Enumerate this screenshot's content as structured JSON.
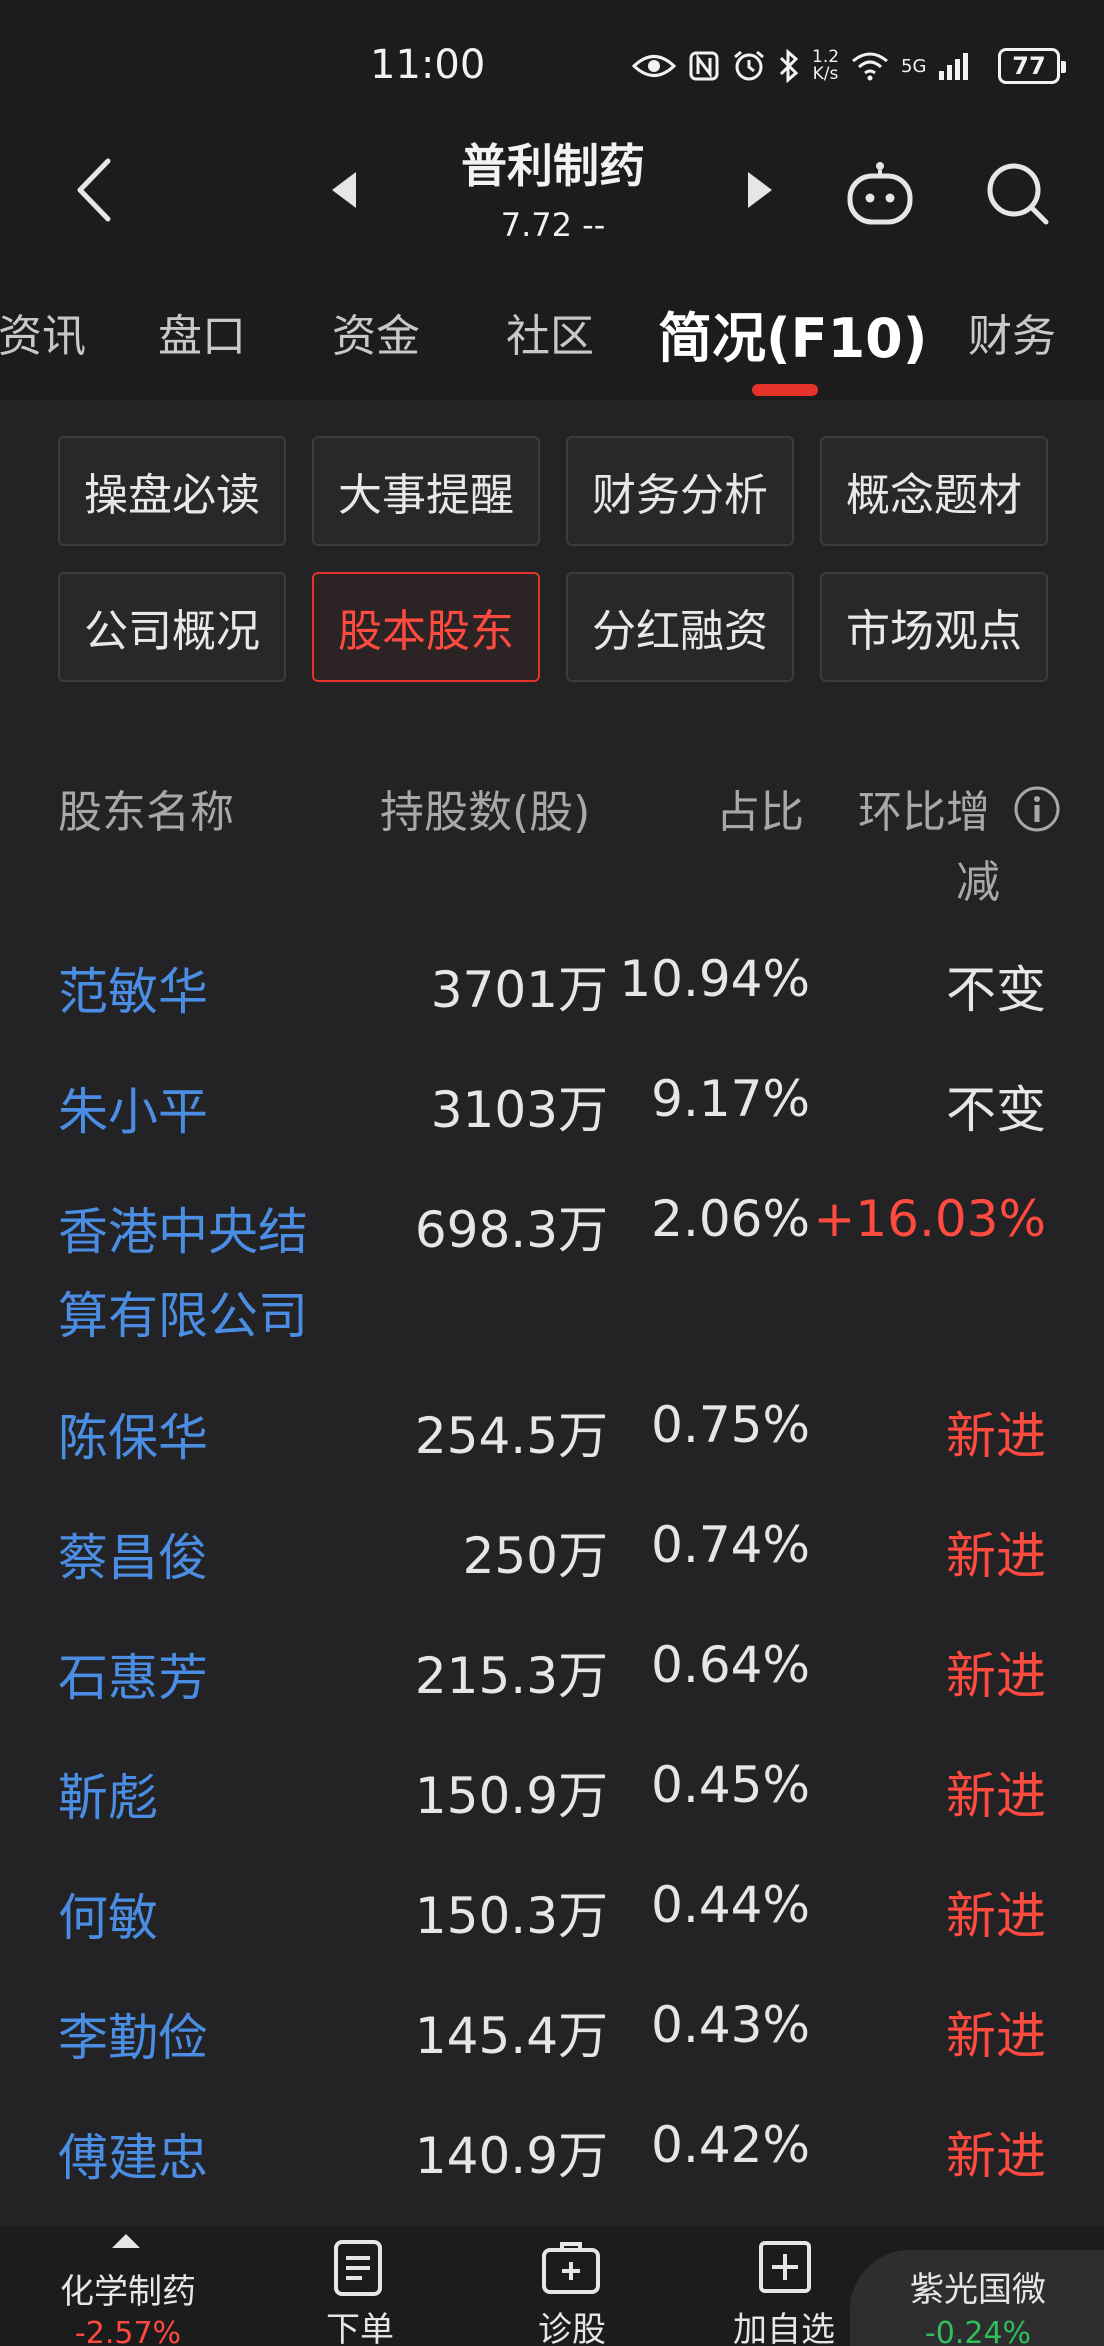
{
  "status_bar": {
    "time": "11:00",
    "net_speed_top": "1.2",
    "net_speed_bottom": "K/s",
    "net_type": "5G",
    "battery": "77"
  },
  "header": {
    "title": "普利制药",
    "price": "7.72",
    "change": "-- "
  },
  "tabs": [
    "资讯",
    "盘口",
    "资金",
    "社区",
    "简况(F10)",
    "财务"
  ],
  "active_tab": "简况(F10)",
  "subnav": {
    "row1": [
      "操盘必读",
      "大事提醒",
      "财务分析",
      "概念题材"
    ],
    "row2": [
      "公司概况",
      "股本股东",
      "分红融资",
      "市场观点"
    ],
    "active": "股本股东"
  },
  "table": {
    "headers": {
      "name": "股东名称",
      "shares": "持股数(股)",
      "ratio": "占比",
      "change_line1": "环比增",
      "change_line2": "减"
    },
    "rows": [
      {
        "name": "范敏华",
        "shares": "3701万",
        "ratio": "10.94%",
        "change": "不变",
        "change_color": "neutral"
      },
      {
        "name": "朱小平",
        "shares": "3103万",
        "ratio": "9.17%",
        "change": "不变",
        "change_color": "neutral"
      },
      {
        "name": "香港中央结算有限公司",
        "shares": "698.3万",
        "ratio": "2.06%",
        "change": "+16.03%",
        "change_color": "red"
      },
      {
        "name": "陈保华",
        "shares": "254.5万",
        "ratio": "0.75%",
        "change": "新进",
        "change_color": "red"
      },
      {
        "name": "蔡昌俊",
        "shares": "250万",
        "ratio": "0.74%",
        "change": "新进",
        "change_color": "red"
      },
      {
        "name": "石惠芳",
        "shares": "215.3万",
        "ratio": "0.64%",
        "change": "新进",
        "change_color": "red"
      },
      {
        "name": "靳彪",
        "shares": "150.9万",
        "ratio": "0.45%",
        "change": "新进",
        "change_color": "red"
      },
      {
        "name": "何敏",
        "shares": "150.3万",
        "ratio": "0.44%",
        "change": "新进",
        "change_color": "red"
      },
      {
        "name": "李勤俭",
        "shares": "145.4万",
        "ratio": "0.43%",
        "change": "新进",
        "change_color": "red"
      },
      {
        "name": "傅建忠",
        "shares": "140.9万",
        "ratio": "0.42%",
        "change": "新进",
        "change_color": "red"
      }
    ]
  },
  "bottom_bar": {
    "sector": {
      "label": "化学制药",
      "value": "-2.57%"
    },
    "order": {
      "label": "下单"
    },
    "diagnose": {
      "label": "诊股"
    },
    "add_watch": {
      "label": "加自选"
    },
    "related": {
      "label": "紫光国微",
      "value": "-0.24%"
    }
  },
  "colors": {
    "accent_red": "#e5332a",
    "link_blue": "#4a8de3",
    "down_green": "#2fbf5b",
    "background": "#232325"
  }
}
